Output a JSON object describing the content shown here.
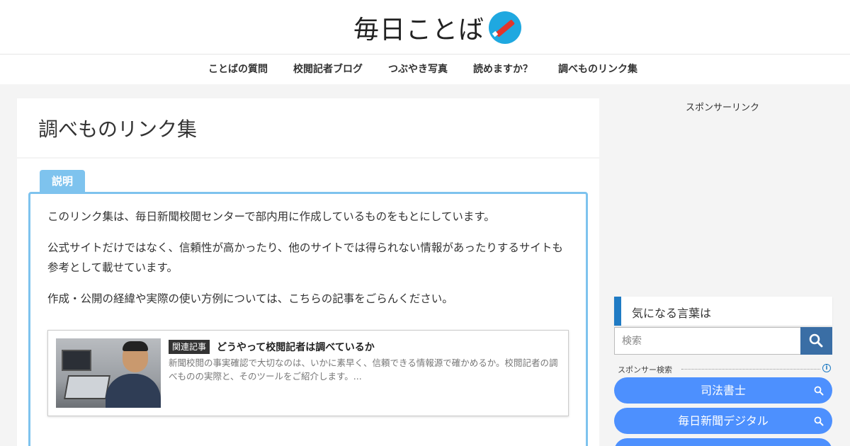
{
  "header": {
    "site_title": "毎日ことば",
    "logo_icon": "pen-circle-icon",
    "logo_color": "#1fa8e0"
  },
  "nav": {
    "items": [
      {
        "label": "ことばの質問"
      },
      {
        "label": "校閲記者ブログ"
      },
      {
        "label": "つぶやき写真"
      },
      {
        "label": "読めますか？"
      },
      {
        "label": "調べものリンク集"
      }
    ]
  },
  "main": {
    "page_title": "調べものリンク集",
    "info_box": {
      "tab_label": "説明",
      "accent_color": "#7ec3ee",
      "paragraphs": [
        "このリンク集は、毎日新聞校閲センターで部内用に作成しているものをもとにしています。",
        "公式サイトだけではなく、信頼性が高かったり、他のサイトでは得られない情報があったりするサイトも参考として載せています。",
        "作成・公開の経緯や実際の使い方例については、こちらの記事をごらんください。"
      ]
    },
    "related_card": {
      "badge": "関連記事",
      "title": "どうやって校閲記者は調べているか",
      "snippet": "新聞校閲の事実確認で大切なのは、いかに素早く、信頼できる情報源で確かめるか。校閲記者の調べものの実際と、そのツールをご紹介します。..."
    }
  },
  "sidebar": {
    "sponsor_label": "スポンサーリンク",
    "widget_title": "気になる言葉は",
    "widget_accent": "#1f7bc4",
    "search": {
      "placeholder": "検索",
      "button_icon": "search-icon"
    },
    "sponsor_search": {
      "label": "スポンサー検索",
      "info_icon": "info-icon",
      "links": [
        {
          "label": "司法書士"
        },
        {
          "label": "毎日新聞デジタル"
        }
      ],
      "pill_color": "#4d90fe"
    }
  }
}
